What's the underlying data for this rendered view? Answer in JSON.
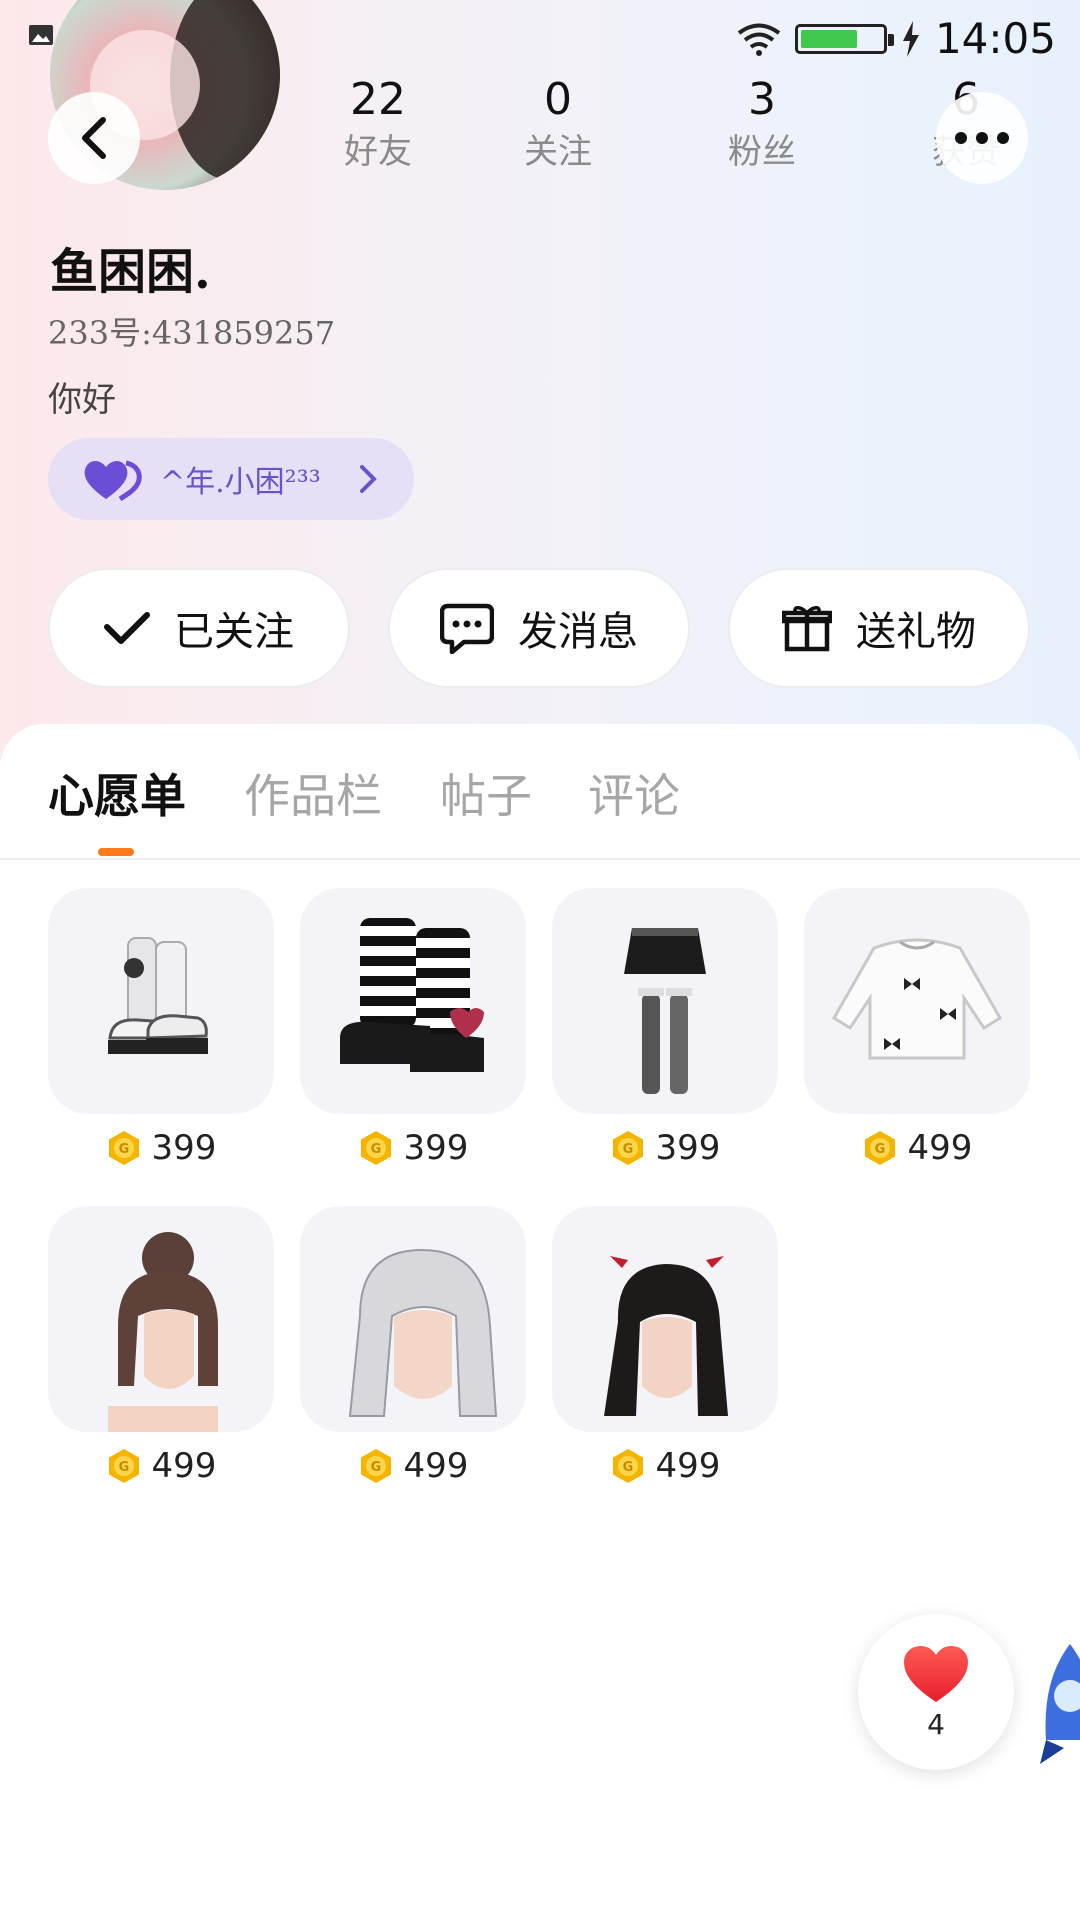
{
  "status_bar": {
    "time": "14:05",
    "battery_level": 0.7,
    "battery_color": "#3ec94d"
  },
  "profile": {
    "stats": [
      {
        "value": "22",
        "label": "好友"
      },
      {
        "value": "0",
        "label": "关注"
      },
      {
        "value": "3",
        "label": "粉丝"
      },
      {
        "value": "6",
        "label": "获赞"
      }
    ],
    "name": "鱼困困.",
    "id_text": "233号:431859257",
    "bio": "你好",
    "couple_tag": "^年.小困²³³"
  },
  "actions": {
    "follow": "已关注",
    "message": "发消息",
    "gift": "送礼物"
  },
  "tabs": [
    "心愿单",
    "作品栏",
    "帖子",
    "评论"
  ],
  "active_tab": "心愿单",
  "accent_color": "#ff7a1a",
  "wishlist": [
    {
      "icon": "white-boots-icon",
      "price": "399"
    },
    {
      "icon": "striped-boots-icon",
      "price": "399"
    },
    {
      "icon": "skirt-stockings-icon",
      "price": "399"
    },
    {
      "icon": "white-blouse-icon",
      "price": "499"
    },
    {
      "icon": "bun-hairstyle-icon",
      "price": "499"
    },
    {
      "icon": "silver-hairstyle-icon",
      "price": "499"
    },
    {
      "icon": "black-hairstyle-icon",
      "price": "499"
    }
  ],
  "like": {
    "count": "4"
  }
}
